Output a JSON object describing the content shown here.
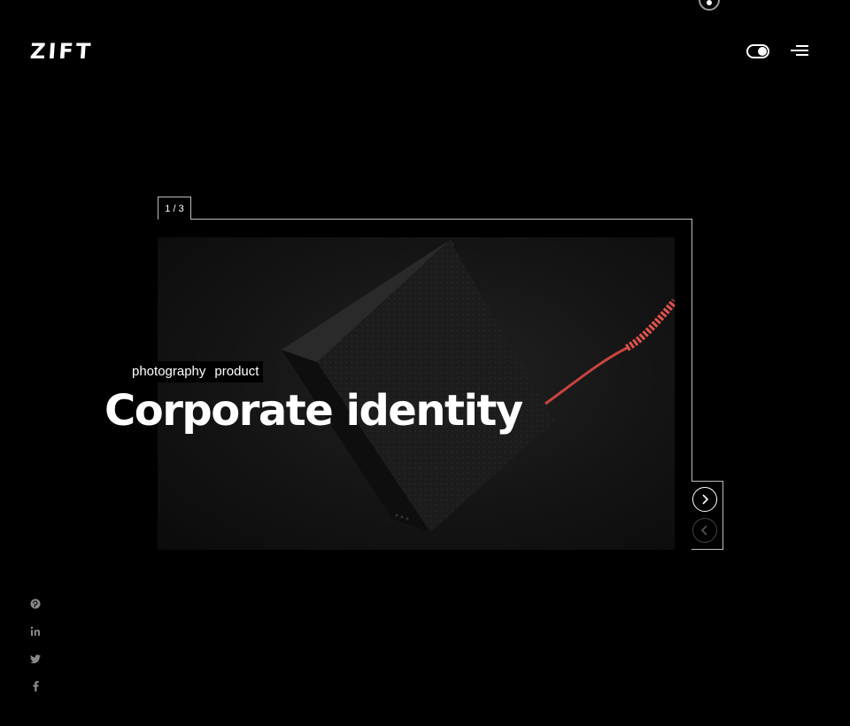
{
  "brand": {
    "logo": "ZIFT"
  },
  "header": {
    "theme_toggle_icon": "toggle-icon",
    "menu_icon": "hamburger-icon"
  },
  "slider": {
    "counter": "1 / 3",
    "tags": [
      "photography",
      "product"
    ],
    "title": "Corporate identity",
    "next_icon": "chevron-right-icon",
    "prev_icon": "chevron-left-icon"
  },
  "social": [
    "pinterest-icon",
    "linkedin-icon",
    "twitter-icon",
    "facebook-icon"
  ],
  "colors": {
    "background": "#000000",
    "text": "#ffffff",
    "frame": "#bdbdbd",
    "accent_cable": "#e0524d"
  }
}
